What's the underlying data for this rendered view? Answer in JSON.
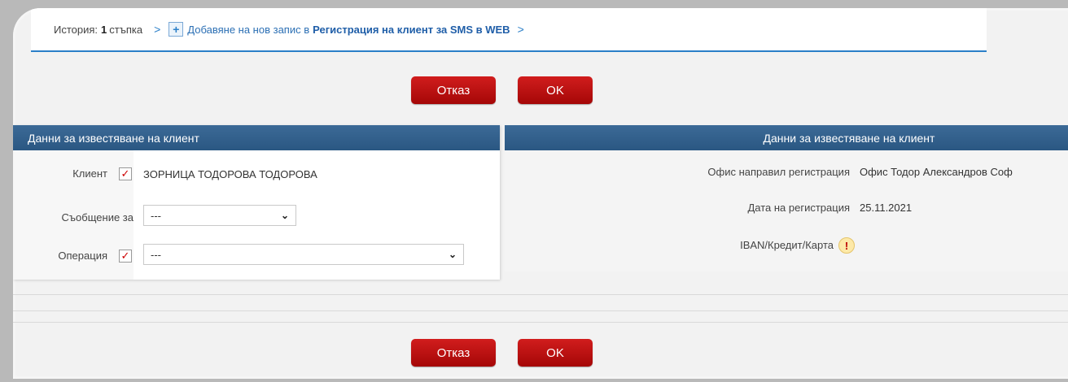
{
  "breadcrumb": {
    "history_label": "История:",
    "step_count": "1",
    "step_word": "стъпка",
    "arrow": ">",
    "action": "Добавяне на нов запис в",
    "entity": "Регистрация на клиент за SMS в WEB"
  },
  "buttons": {
    "cancel": "Отказ",
    "ok": "OK"
  },
  "left_panel": {
    "title": "Данни за известяване на клиент",
    "client_label": "Клиент",
    "client_value": "ЗОРНИЦА ТОДОРОВА ТОДОРОВА",
    "message_label": "Съобщение за",
    "message_value": "---",
    "operation_label": "Операция",
    "operation_value": "---"
  },
  "right_panel": {
    "title": "Данни за известяване на клиент",
    "office_label": "Офис направил регистрация",
    "office_value": "Офис Тодор Александров Соф",
    "date_label": "Дата на регистрация",
    "date_value": "25.11.2021",
    "iban_label": "IBAN/Кредит/Карта"
  },
  "icons": {
    "check": "✓",
    "warning": "!"
  },
  "colors": {
    "accent_blue": "#2b7fc8",
    "header_blue": "#2f5d8a",
    "button_red": "#c00d0d"
  }
}
